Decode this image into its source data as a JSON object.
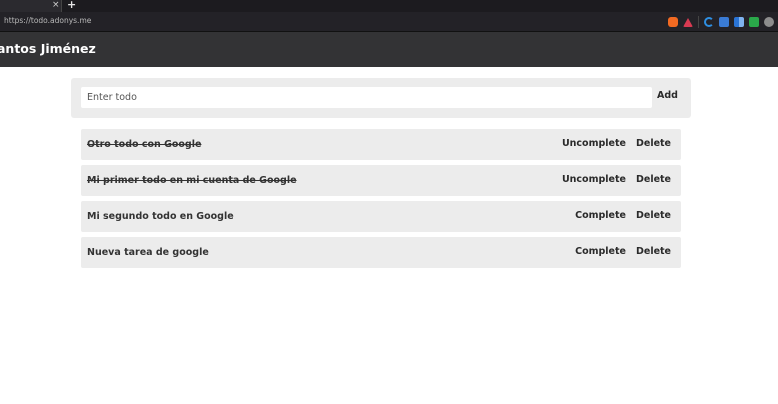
{
  "browser": {
    "new_tab_label": "+",
    "close_tab_label": "×",
    "url": "https://todo.adonys.me",
    "extensions": [
      "brave-shield-icon",
      "alert-icon",
      "c-icon",
      "blue-extension-icon",
      "multi-extension-icon",
      "green-extension-icon",
      "grey-extension-icon"
    ]
  },
  "header": {
    "title": "antos Jiménez"
  },
  "input": {
    "placeholder": "Enter todo",
    "value": "",
    "add_label": "Add"
  },
  "todos": [
    {
      "text": "Otro todo con Google",
      "done": true,
      "toggle_label": "Uncomplete",
      "delete_label": "Delete"
    },
    {
      "text": "Mi primer todo en mi cuenta de Google",
      "done": true,
      "toggle_label": "Uncomplete",
      "delete_label": "Delete"
    },
    {
      "text": "Mi segundo todo en Google",
      "done": false,
      "toggle_label": "Complete",
      "delete_label": "Delete"
    },
    {
      "text": "Nueva tarea de google",
      "done": false,
      "toggle_label": "Complete",
      "delete_label": "Delete"
    }
  ],
  "colors": {
    "header_bg": "#333335",
    "panel_bg": "#ececec",
    "chrome_bg": "#1c1b1f"
  }
}
